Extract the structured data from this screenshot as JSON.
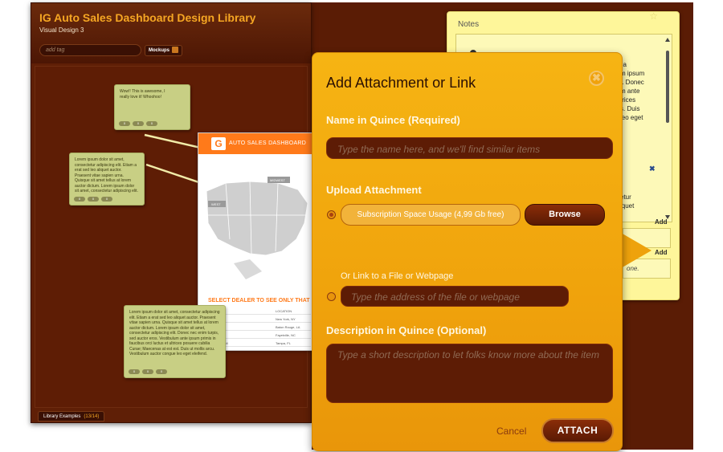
{
  "board": {
    "title": "IG Auto Sales Dashboard Design Library",
    "subtitle": "Visual Design 3",
    "tag_placeholder": "add tag",
    "mockups_label": "Mockups",
    "library_tab": "Library Examples",
    "library_count": "(13/14)"
  },
  "stickies": [
    {
      "text": "Wow!! This is awesome, I really love it! Whoohoo!",
      "counts": [
        "0",
        "0",
        "0"
      ]
    },
    {
      "text": "Lorem ipsum dolor sit amet, consectetur adipiscing elit. Etiam a erat sed leo aliquet auctor. Praesent vitae sapien urna. Quisque sit amet tellus at lorem auctor dictum. Lorem ipsum dolor sit amet, consectetur adipiscing elit.",
      "counts": [
        "0",
        "0",
        "0"
      ]
    },
    {
      "text": "Lorem ipsum dolor sit amet, consectetur adipiscing elit. Etiam a erat sed leo aliquet auctor. Praesent vitae sapien urna. Quisque sit amet tellus at lorem auctor dictum. Lorem ipsum dolor sit amet, consectetur adipiscing elit. Donec nec enim turpis, sed auctor eros. Vestibulum ante ipsum primis in faucibus orci luctus et ultrices posuere cubilia Curae; Maecenas at est est. Duis ut mollis arcu. Vestibulum auctor congue leo eget eleifend.",
      "counts": [
        "0",
        "0",
        "0"
      ]
    }
  ],
  "mockup": {
    "logo": "G",
    "title": "AUTO SALES DASHBOARD",
    "cta": "SELECT DEALER TO SEE ONLY THAT",
    "region_midwest": "MIDWEST",
    "region_west": "WEST",
    "location_header": "LOCATION",
    "rows": [
      {
        "dealer": "Autoway",
        "location": "New York, NY"
      },
      {
        "dealer": "gines",
        "location": "Baton Rouge, LA"
      },
      {
        "dealer": "e Autos",
        "location": "Fayetville, NC"
      },
      {
        "dealer": "er's Trendi",
        "location": "Tampa, FL"
      }
    ]
  },
  "notes": {
    "title": "Notes",
    "lines_top": [
      "lla",
      "m ipsum",
      "t. Donec",
      "m ante",
      "trices",
      "s. Duis",
      "leo eget"
    ],
    "lines_bottom": [
      "etur",
      "iquet"
    ],
    "add_label_1": "Add",
    "add_label_2": "Add",
    "input2_text": "one.",
    "close_glyph": "✖"
  },
  "dialog": {
    "title": "Add Attachment or Link",
    "close_glyph": "✖",
    "name_label": "Name in Quince (Required)",
    "name_placeholder": "Type the name here, and we'll find similar items",
    "upload_label": "Upload Attachment",
    "usage_text": "Subscription Space Usage (4,99 Gb free)",
    "browse_label": "Browse",
    "link_label": "Or Link to a File or Webpage",
    "link_placeholder": "Type the address of the file or webpage",
    "desc_label": "Description in Quince (Optional)",
    "desc_placeholder": "Type a short description to let folks know more about the item",
    "cancel_label": "Cancel",
    "attach_label": "ATTACH"
  },
  "colors": {
    "accent": "#f5a623",
    "board_bg": "#5f1f06",
    "dialog_bg": "#f0a30c",
    "notes_bg": "#fef69a",
    "sticky_bg": "#c8cf84"
  }
}
